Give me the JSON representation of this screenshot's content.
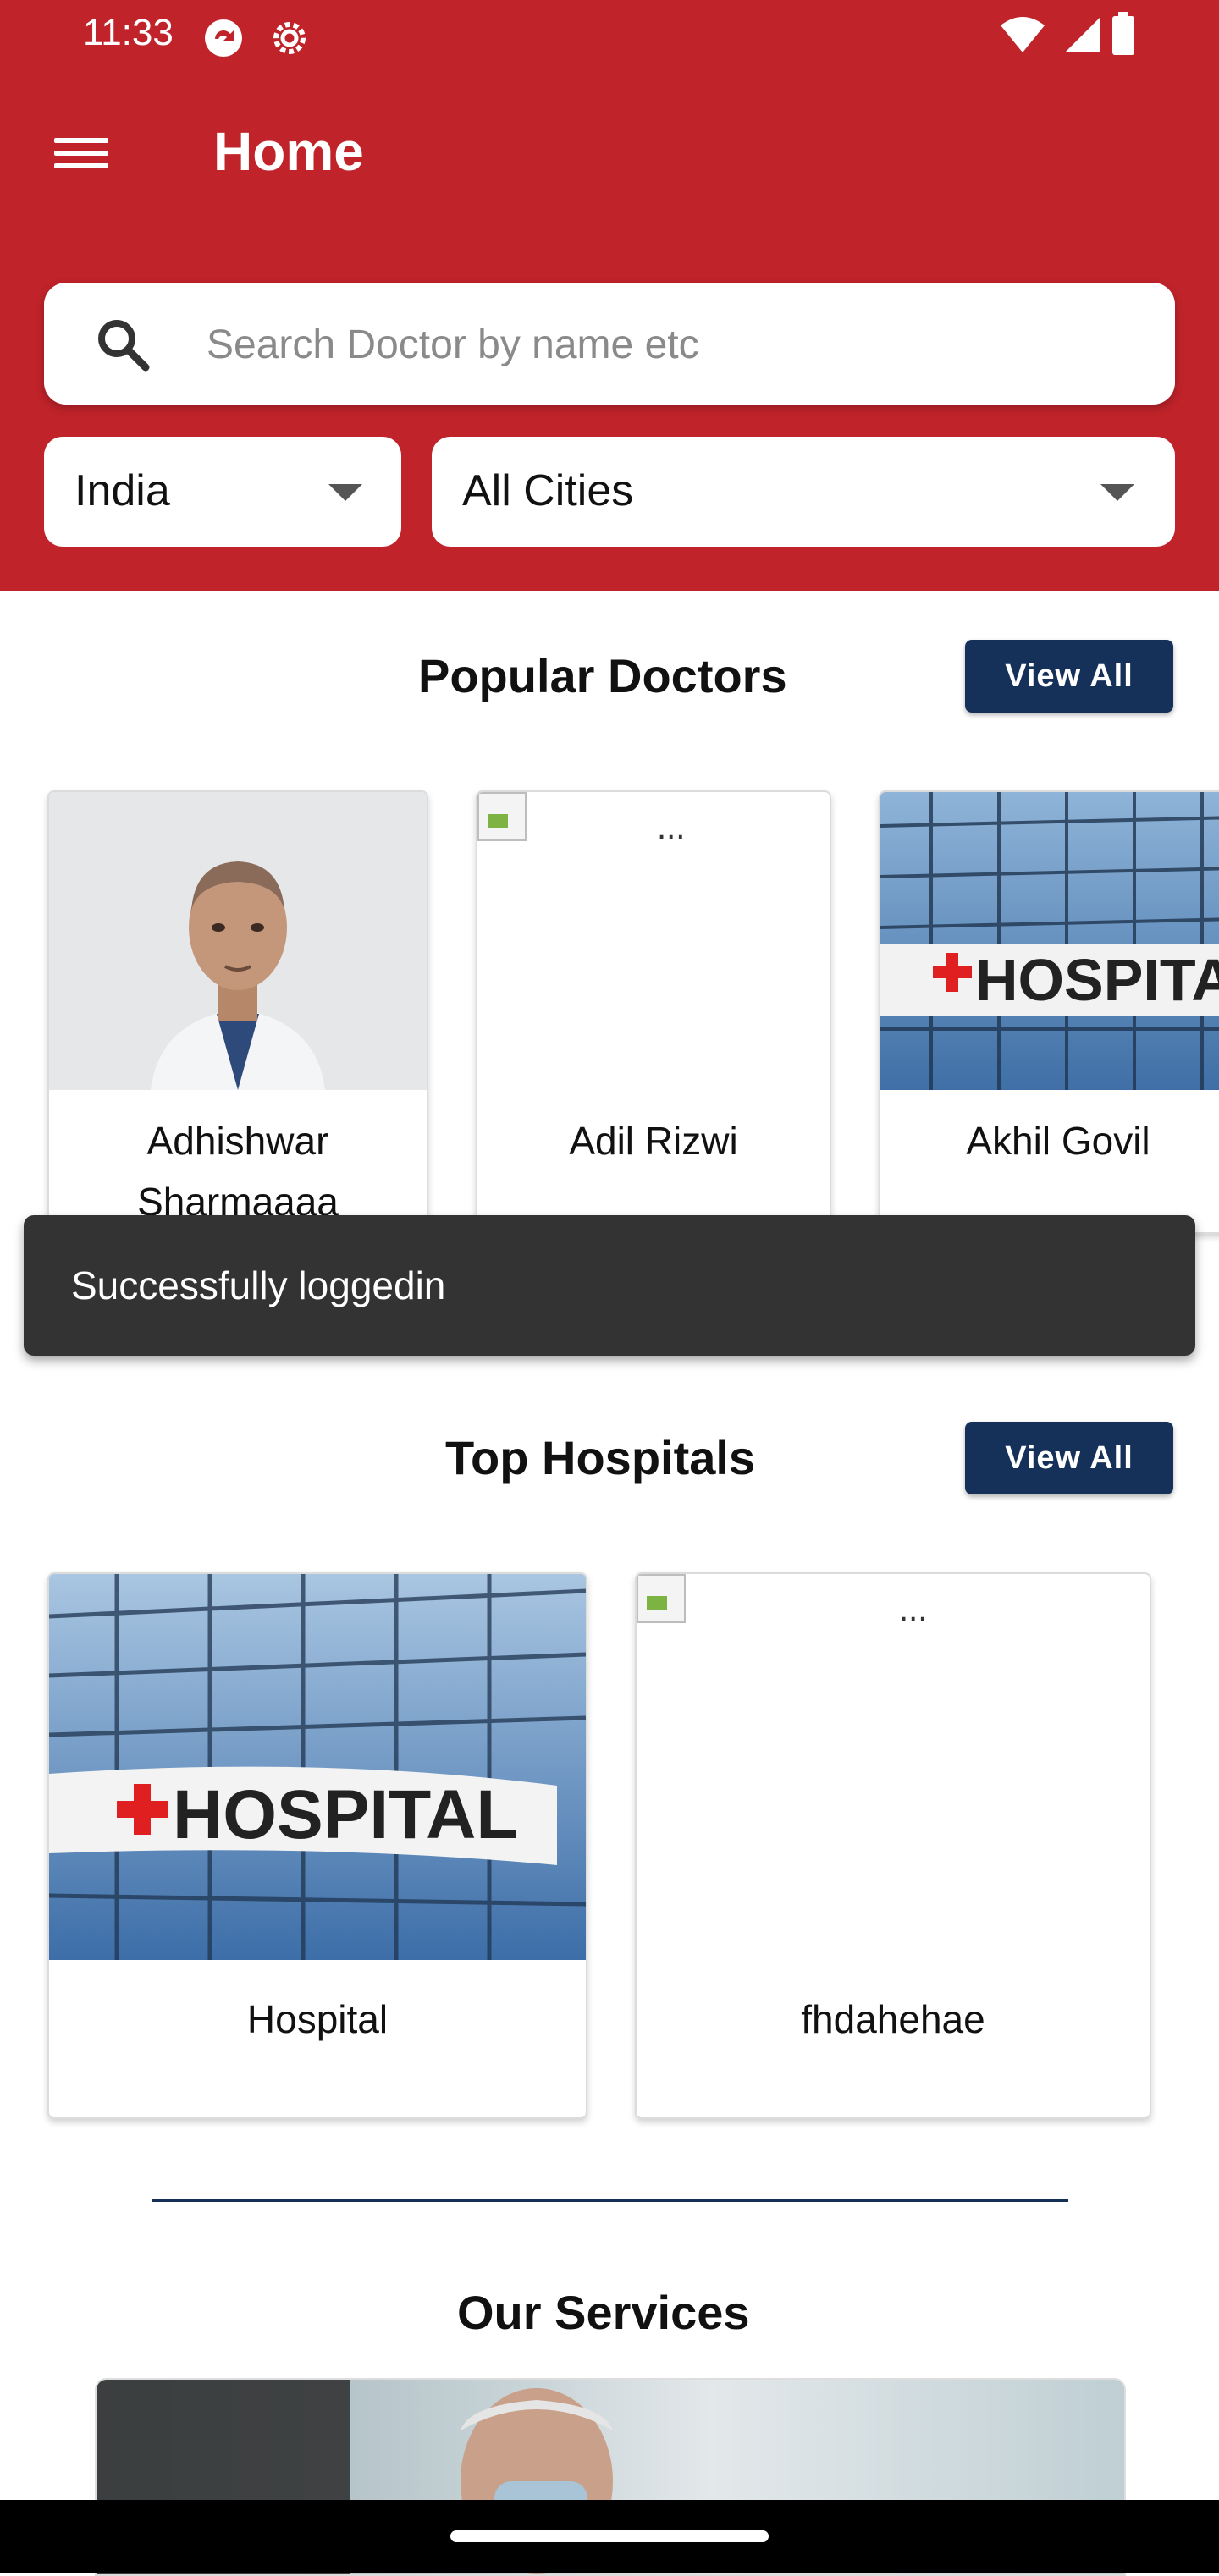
{
  "status_bar": {
    "time": "11:33"
  },
  "app_bar": {
    "title": "Home"
  },
  "search": {
    "placeholder": "Search Doctor by name etc"
  },
  "filters": {
    "country": "India",
    "city": "All Cities"
  },
  "popular_doctors": {
    "title": "Popular Doctors",
    "view_all": "View All",
    "doctors": [
      {
        "name": "Adhishwar Sharmaaaa"
      },
      {
        "name": "Adil Rizwi",
        "image_alt": "..."
      },
      {
        "name": "Akhil Govil"
      }
    ]
  },
  "toast": {
    "message": "Successfully loggedin"
  },
  "top_hospitals": {
    "title": "Top Hospitals",
    "view_all": "View All",
    "hospitals": [
      {
        "name": "Hospital",
        "sign_text": "HOSPITAL"
      },
      {
        "name": "fhdahehae",
        "image_alt": "..."
      }
    ]
  },
  "services": {
    "title": "Our Services"
  },
  "colors": {
    "primary_red": "#c0232a",
    "navy": "#15315a",
    "toast_bg": "#333333"
  }
}
